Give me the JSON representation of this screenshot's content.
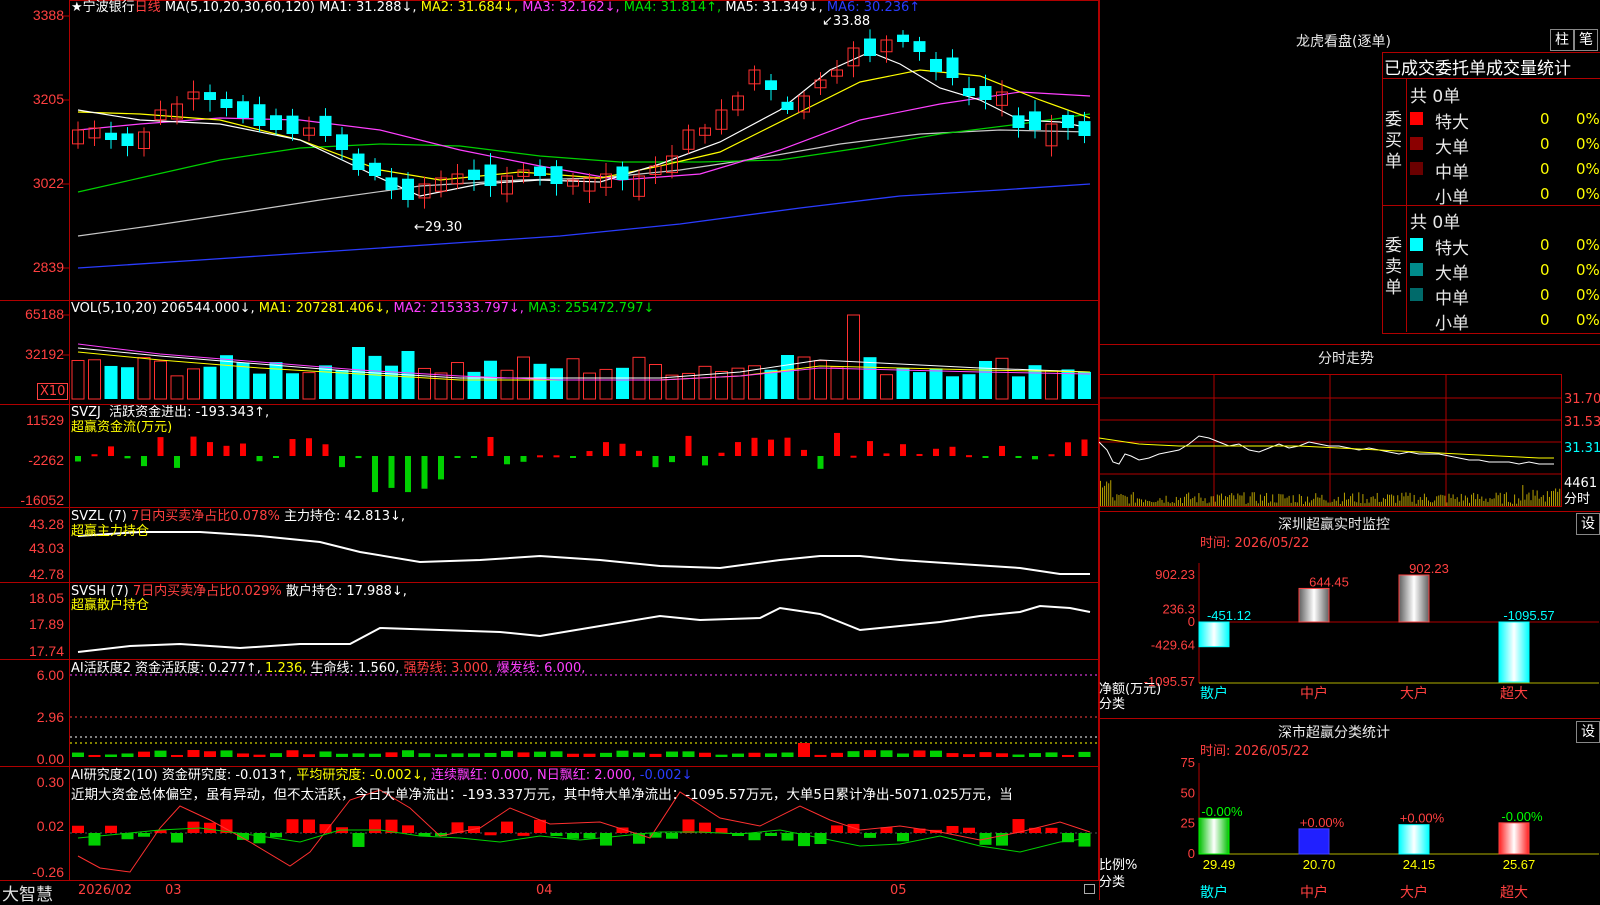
{
  "stock": {
    "star": "★",
    "name": "宁波银行",
    "period": "日线"
  },
  "ma_header": {
    "params": "MA(5,10,20,30,60,120)",
    "ma1": "MA1: 31.288↓,",
    "ma2": "MA2: 31.684↓,",
    "ma3": "MA3: 32.162↓,",
    "ma4": "MA4: 31.814↑,",
    "ma5": "MA5: 31.349↓,",
    "ma6": "MA6: 30.236↑"
  },
  "price_axis": [
    "3388",
    "3205",
    "3022",
    "2839"
  ],
  "price_annotations": {
    "high": "33.88",
    "low": "29.30"
  },
  "vol_header": {
    "params": "VOL(5,10,20)",
    "value": "206544.000↓,",
    "ma1": "MA1: 207281.406↓,",
    "ma2": "MA2: 215333.797↓,",
    "ma3": "MA3: 255472.797↓"
  },
  "vol_axis": [
    "65188",
    "32192"
  ],
  "vol_unit": "X10",
  "svzj_header": {
    "name": "SVZJ",
    "label": "活跃资金进出: -193.343↑,",
    "sub": "超赢资金流(万元)"
  },
  "svzj_axis": [
    "11529",
    "-2262",
    "-16052"
  ],
  "svzl_header": {
    "name": "SVZL (7)",
    "label1": "7日内买卖净占比0.078%",
    "label2": "主力持仓: 42.813↓,",
    "sub": "超赢主力持仓"
  },
  "svzl_axis": [
    "43.28",
    "43.03",
    "42.78"
  ],
  "svsh_header": {
    "name": "SVSH (7)",
    "label1": "7日内买卖净占比0.029%",
    "label2": "散户持仓: 17.988↓,",
    "sub": "超赢散户持仓"
  },
  "svsh_axis": [
    "18.05",
    "17.89",
    "17.74"
  ],
  "ai_active_header": {
    "name": "AI活跃度2",
    "l1": "资金活跃度: 0.277↑,",
    "l2": "1.236,",
    "l3": "生命线: 1.560,",
    "l4": "强势线: 3.000,",
    "l5": "爆发线: 6.000,"
  },
  "ai_active_axis": [
    "6.00",
    "2.96",
    "0.00"
  ],
  "ai_research_header": {
    "name": "AI研究度2(10)",
    "l1": "资金研究度: -0.013↑,",
    "l2": "平均研究度: -0.002↓,",
    "l3": "连续飘红: 0.000,",
    "l4": "N日飘红: 2.000,",
    "l5": "-0.002↓"
  },
  "ai_research_text": "近期大资金总体偏空，虽有异动，但不太活跃，今日大单净流出：-193.337万元，其中特大单净流出：-1095.57万元，大单5日累计净出-5071.025万元，当",
  "ai_research_axis": [
    "0.30",
    "0.02",
    "-0.26"
  ],
  "time_axis": {
    "brand": "大智慧",
    "year": "2026/02",
    "m3": "03",
    "m4": "04",
    "m5": "05"
  },
  "dragon": {
    "title": "龙虎看盘(逐单)",
    "btn1": "柱",
    "btn2": "笔",
    "table_title": "已成交委托单成交量统计"
  },
  "buy_side": {
    "side_label": [
      "委",
      "买",
      "单"
    ],
    "total": "共 0单",
    "rows": [
      {
        "label": "特大",
        "vol": "0",
        "pct": "0%",
        "color": "#ff0000"
      },
      {
        "label": "大单",
        "vol": "0",
        "pct": "0%",
        "color": "#8b0000"
      },
      {
        "label": "中单",
        "vol": "0",
        "pct": "0%",
        "color": "#6a0000"
      },
      {
        "label": "小单",
        "vol": "0",
        "pct": "0%",
        "color": "#000000"
      }
    ]
  },
  "sell_side": {
    "side_label": [
      "委",
      "卖",
      "单"
    ],
    "total": "共 0单",
    "rows": [
      {
        "label": "特大",
        "vol": "0",
        "pct": "0%",
        "color": "#00ffff"
      },
      {
        "label": "大单",
        "vol": "0",
        "pct": "0%",
        "color": "#008b8b"
      },
      {
        "label": "中单",
        "vol": "0",
        "pct": "0%",
        "color": "#006a6a"
      },
      {
        "label": "小单",
        "vol": "0",
        "pct": "0%",
        "color": "#000000"
      }
    ]
  },
  "intraday": {
    "title": "分时走势",
    "axis": [
      "31.70",
      "31.53",
      "31.31"
    ],
    "vol_label": "4461",
    "unit": "分时"
  },
  "monitor": {
    "title": "深圳超赢实时监控",
    "gear": "设",
    "time": "时间: 2026/05/22",
    "axis": [
      "902.23",
      "236.3",
      "0",
      "-429.64",
      "-1095.57"
    ],
    "unit1": "净额(万元)",
    "unit2": "分类",
    "categories": [
      "散户",
      "中户",
      "大户",
      "超大"
    ],
    "values": [
      -451.12,
      644.45,
      902.23,
      -1095.57
    ],
    "value_labels": [
      "-451.12",
      "644.45",
      "902.23",
      "-1095.57"
    ]
  },
  "classify": {
    "title": "深市超赢分类统计",
    "gear": "设",
    "time": "时间: 2026/05/22",
    "axis": [
      "75",
      "50",
      "25",
      "0"
    ],
    "unit1": "比例%",
    "unit2": "分类",
    "categories": [
      "散户",
      "中户",
      "大户",
      "超大"
    ],
    "values": [
      29.49,
      20.7,
      24.15,
      25.67
    ],
    "value_labels": [
      "29.49",
      "20.70",
      "24.15",
      "25.67"
    ],
    "change_labels": [
      "-0.00%",
      "+0.00%",
      "+0.00%",
      "-0.00%"
    ]
  },
  "chart_data": [
    {
      "type": "candlestick",
      "title": "宁波银行 日线",
      "ylim": [
        28.39,
        33.88
      ],
      "axis_ticks": [
        "3388",
        "3205",
        "3022",
        "2839"
      ],
      "x_ticks": [
        "2026/02",
        "03",
        "04",
        "05"
      ],
      "high": 33.88,
      "low": 29.3
    },
    {
      "type": "bar",
      "title": "SVZJ 超赢资金流(万元)",
      "ylim": [
        -16052,
        11529
      ]
    },
    {
      "type": "bar",
      "title": "深圳超赢实时监控",
      "categories": [
        "散户",
        "中户",
        "大户",
        "超大"
      ],
      "values": [
        -451.12,
        644.45,
        902.23,
        -1095.57
      ],
      "ylim": [
        -1095.57,
        902.23
      ]
    },
    {
      "type": "bar",
      "title": "深市超赢分类统计",
      "categories": [
        "散户",
        "中户",
        "大户",
        "超大"
      ],
      "values": [
        29.49,
        20.7,
        24.15,
        25.67
      ],
      "ylim": [
        0,
        75
      ]
    }
  ]
}
